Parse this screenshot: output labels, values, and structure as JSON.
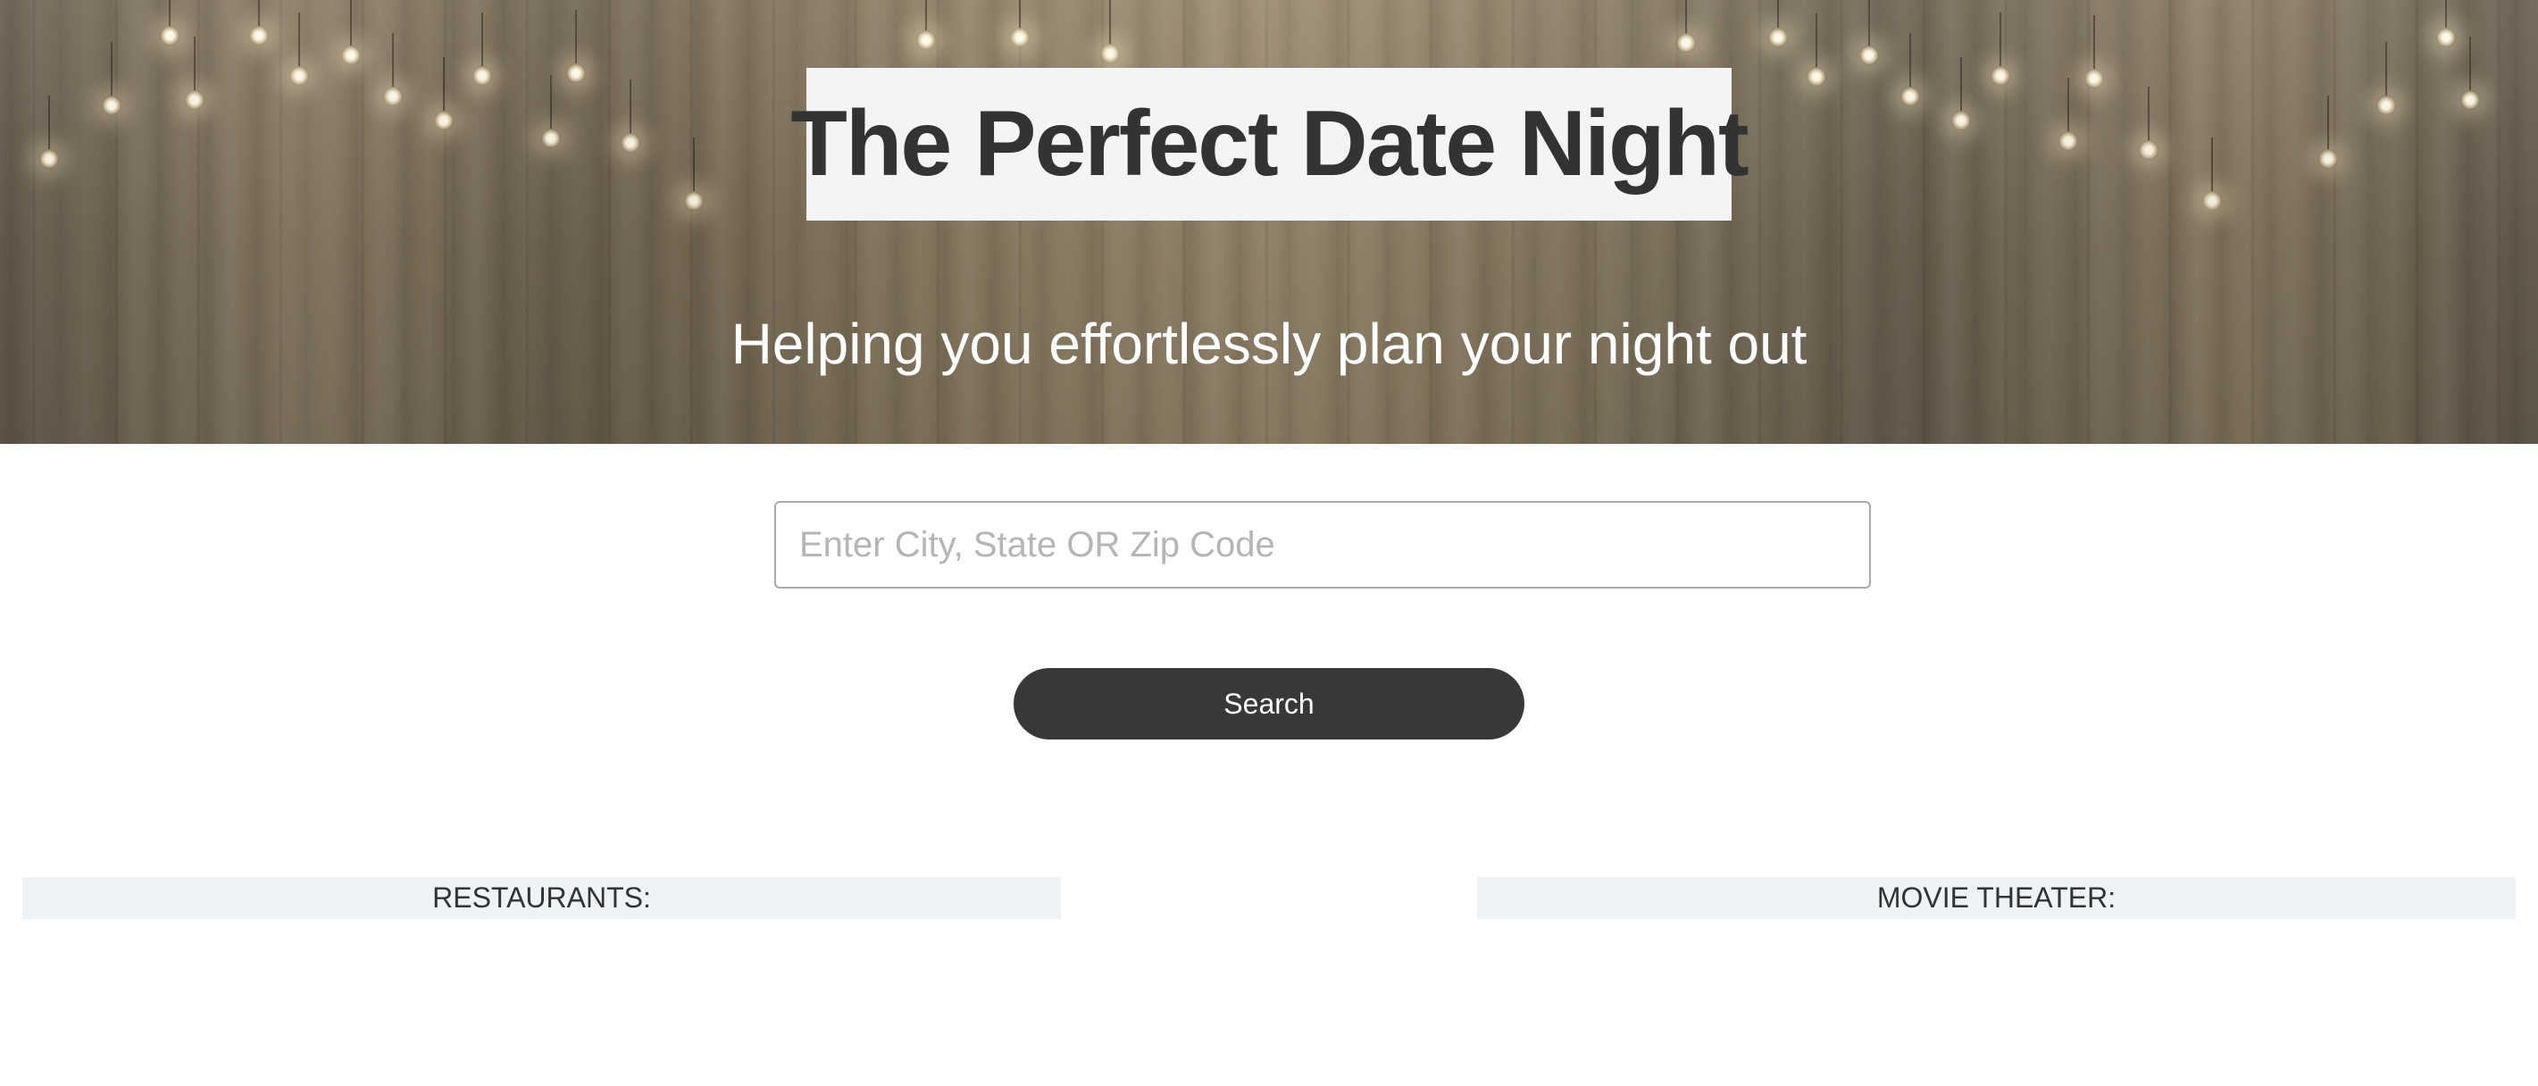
{
  "hero": {
    "title": "The Perfect Date Night",
    "subtitle": "Helping you effortlessly plan your night out"
  },
  "search": {
    "value": "",
    "placeholder": "Enter City, State OR Zip Code",
    "button_label": "Search",
    "button_color": "#383838"
  },
  "results": {
    "restaurants_header": "RESTAURANTS:",
    "movies_header": "MOVIE THEATER:",
    "header_background": "#eff3f6"
  }
}
